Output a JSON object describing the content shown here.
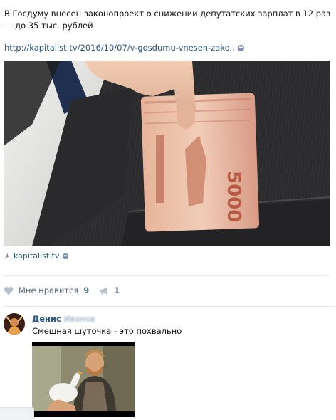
{
  "post": {
    "text": "В Госдуму внесен законопроект о снижении депутатских зарплат в 12 раз — до 35 тыс. рублей",
    "link": "http://kapitalist.tv/2016/10/07/v-gosdumu-vnesen-zako..",
    "image_icon": "banknotes-in-pocket-photo",
    "source": "kapitalist.tv"
  },
  "actions": {
    "like_label": "Мне нравится",
    "like_count": "9",
    "share_count": "1"
  },
  "comment": {
    "author": "Денис",
    "author_blurred": "Иванов",
    "text": "Смешная шуточка - это похвально",
    "image_icon": "man-with-goose-photo"
  },
  "colors": {
    "link": "#2a5885",
    "icon": "#b7c2cf",
    "count": "#56708f",
    "divider": "#e7e8ec"
  }
}
